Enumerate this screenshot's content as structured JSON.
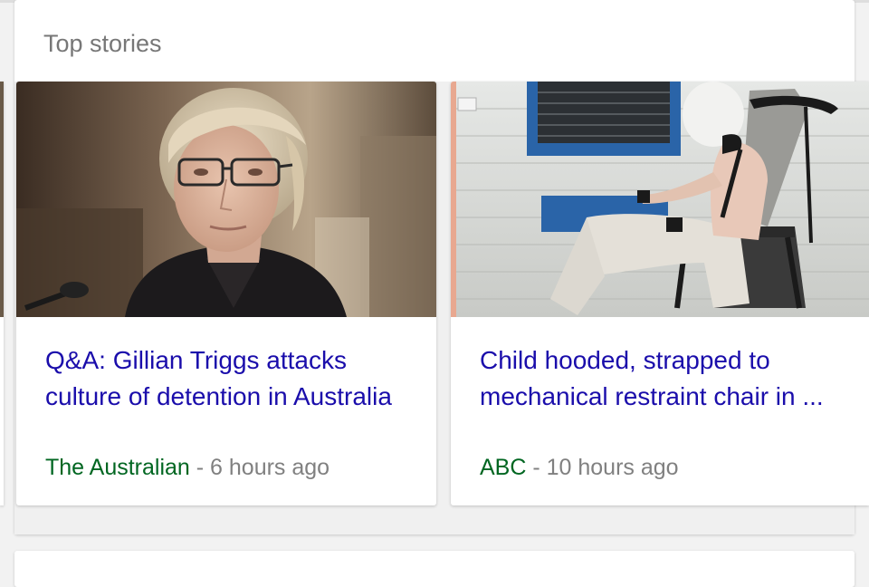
{
  "section": {
    "title": "Top stories"
  },
  "stories": [
    {
      "headline": "Q&A: Gillian Triggs attacks culture of detention in Australia",
      "source": "The Australian",
      "separator": " - ",
      "time": "6 hours ago"
    },
    {
      "headline": "Child hooded, strapped to mechanical restraint chair in ...",
      "source": "ABC",
      "separator": " - ",
      "time": "10 hours ago"
    }
  ],
  "colors": {
    "headline": "#1a0dab",
    "source": "#006621",
    "meta": "#808080",
    "title": "#777777"
  }
}
